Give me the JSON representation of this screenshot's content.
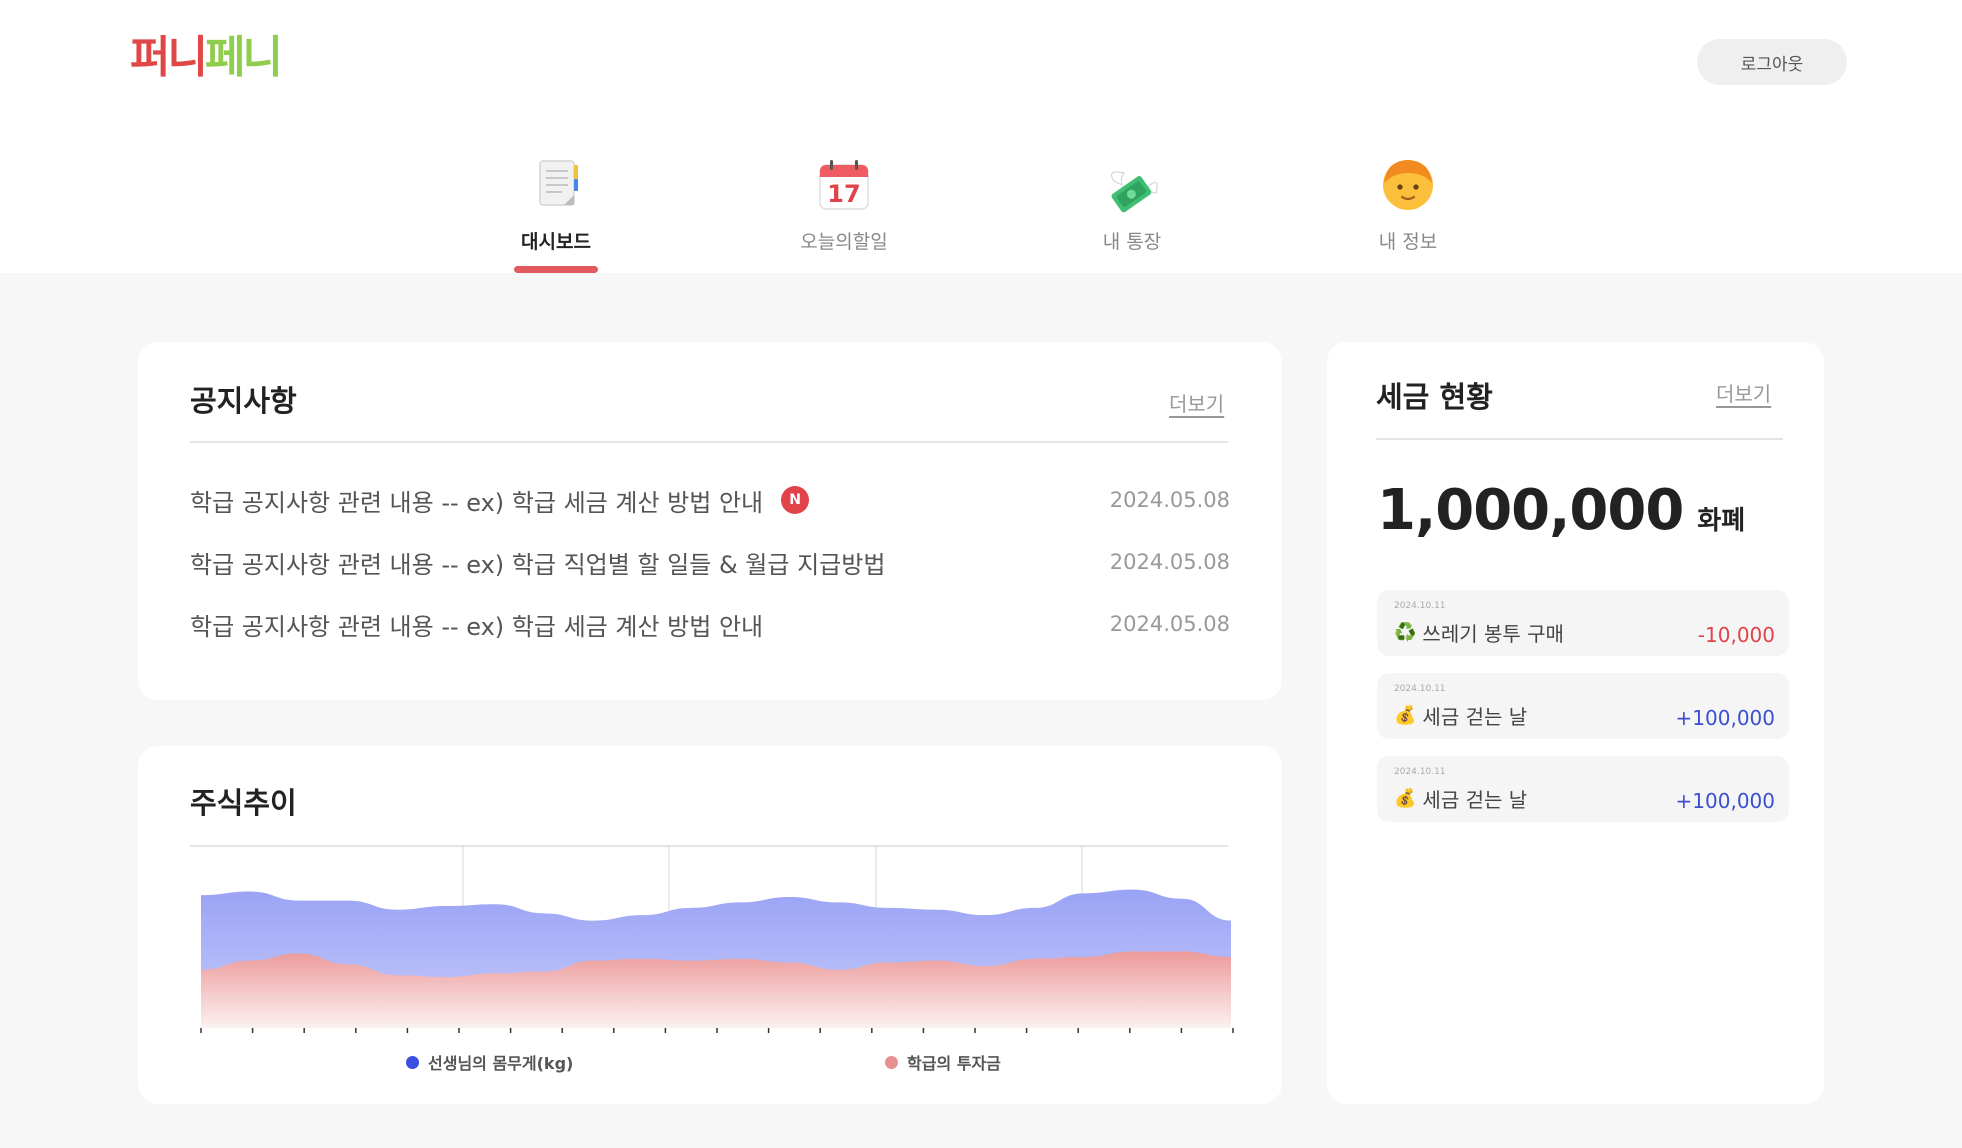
{
  "app": {
    "logo_part1": "퍼니",
    "logo_part2": "페니",
    "logout_label": "로그아웃"
  },
  "nav": {
    "items": [
      {
        "label": "대시보드",
        "icon": "notepad-icon",
        "active": true
      },
      {
        "label": "오늘의할일",
        "icon": "calendar-icon",
        "calendar_day": "17"
      },
      {
        "label": "내 통장",
        "icon": "money-wings-icon"
      },
      {
        "label": "내 정보",
        "icon": "child-face-icon"
      }
    ]
  },
  "notice": {
    "title": "공지사항",
    "more_label": "더보기",
    "new_badge": "N",
    "items": [
      {
        "text": "학급 공지사항 관련 내용 -- ex) 학급 세금 계산 방법 안내",
        "date": "2024.05.08",
        "is_new": true
      },
      {
        "text": "학급 공지사항 관련 내용 -- ex) 학급 직업별 할 일들 & 월급 지급방법",
        "date": "2024.05.08",
        "is_new": false
      },
      {
        "text": "학급 공지사항 관련 내용 -- ex) 학급 세금 계산 방법 안내",
        "date": "2024.05.08",
        "is_new": false
      }
    ]
  },
  "tax": {
    "title": "세금 현황",
    "more_label": "더보기",
    "amount": "1,000,000",
    "unit": "화폐",
    "transactions": [
      {
        "date": "2024.10.11",
        "emoji": "♻️",
        "icon": "recycle-icon",
        "label": "쓰레기 봉투 구매",
        "amount": "-10,000",
        "type": "negative"
      },
      {
        "date": "2024.10.11",
        "emoji": "💰",
        "icon": "money-bag-icon",
        "label": "세금 걷는 날",
        "amount": "+100,000",
        "type": "positive"
      },
      {
        "date": "2024.10.11",
        "emoji": "💰",
        "icon": "money-bag-icon",
        "label": "세금 걷는 날",
        "amount": "+100,000",
        "type": "positive"
      }
    ]
  },
  "colors": {
    "accent": "#e05a5f",
    "negative": "#e0444a",
    "positive": "#3b4fd0",
    "series_blue": "#3b4fe0",
    "series_red": "#e88f8f"
  },
  "stock": {
    "title": "주식추이"
  },
  "chart_data": {
    "type": "area",
    "title": "주식추이",
    "x_ticks": 21,
    "y_range": [
      0,
      100
    ],
    "grid": "vertical",
    "legend_position": "bottom",
    "series": [
      {
        "name": "선생님의 몸무게(kg)",
        "color": "#3b4fe0",
        "values": [
          73,
          75,
          70,
          70,
          65,
          67,
          68,
          63,
          59,
          62,
          66,
          69,
          72,
          69,
          66,
          65,
          62,
          66,
          74,
          76,
          71,
          59
        ]
      },
      {
        "name": "학급의 투자금",
        "color": "#e88f8f",
        "values": [
          32,
          37,
          41,
          35,
          29,
          28,
          30,
          31,
          37,
          38,
          37,
          38,
          36,
          32,
          36,
          37,
          34,
          38,
          39,
          42,
          42,
          39
        ]
      }
    ]
  }
}
